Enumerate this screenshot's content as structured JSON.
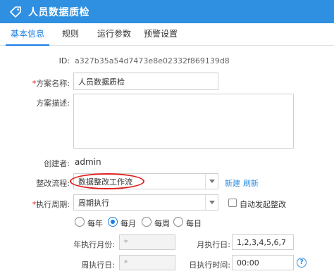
{
  "window": {
    "title": "人员数据质检",
    "icon": "tag-icon"
  },
  "tabs": [
    {
      "label": "基本信息",
      "active": true
    },
    {
      "label": "规则",
      "active": false
    },
    {
      "label": "运行参数",
      "active": false
    },
    {
      "label": "预警设置",
      "active": false
    }
  ],
  "form": {
    "id_label": "ID:",
    "id_value": "a327b35a54d7473e8e02332f869139d8",
    "name_label": "方案名称:",
    "name_value": "人员数据质检",
    "desc_label": "方案描述:",
    "desc_value": "",
    "creator_label": "创建者:",
    "creator_value": "admin",
    "process_label": "整改流程:",
    "process_value": "数据整改工作流",
    "process_new": "新建",
    "process_refresh": "刷新",
    "cycle_label": "执行周期:",
    "cycle_value": "周期执行",
    "auto_label": "自动发起整改",
    "auto_checked": false,
    "frequency_options": [
      {
        "label": "每年",
        "selected": false
      },
      {
        "label": "每月",
        "selected": true
      },
      {
        "label": "每周",
        "selected": false
      },
      {
        "label": "每日",
        "selected": false
      }
    ],
    "month_label": "年执行月份:",
    "month_value": "*",
    "day_label": "月执行日:",
    "day_value": "1,2,3,4,5,6,7",
    "week_label": "周执行日:",
    "week_value": "*",
    "time_label": "日执行时间:",
    "time_value": "00:00",
    "required_mark": "*"
  },
  "colors": {
    "titlebar": "#2f8fe0",
    "accent": "#1a7ee0",
    "highlight": "#e21f1f"
  }
}
